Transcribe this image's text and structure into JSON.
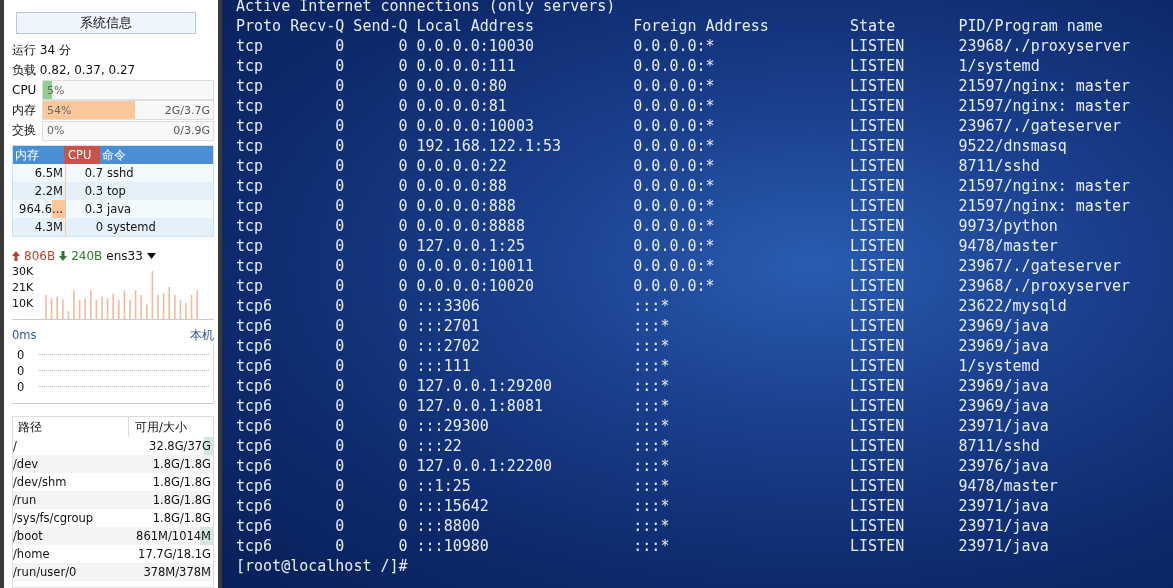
{
  "sidebar": {
    "title": "系统信息",
    "uptime": "运行 34 分",
    "load": "负载 0.82, 0.37, 0.27",
    "meters": [
      {
        "label": "CPU",
        "reading": "5%",
        "level": 0.05,
        "color": "#8fd08f"
      },
      {
        "label": "内存",
        "reading": "54%",
        "total": "2G/3.7G",
        "level": 0.54,
        "color": "#fcc89b"
      },
      {
        "label": "交换",
        "reading": "0%",
        "total": "0/3.9G"
      }
    ],
    "process_columns": [
      "内存",
      "CPU",
      "命令"
    ],
    "processes": [
      {
        "mem": "6.5M",
        "cpu": "0.7",
        "cmd": "sshd"
      },
      {
        "mem": "2.2M",
        "cpu": "0.3",
        "cmd": "top"
      },
      {
        "mem": "964.6...",
        "cpu": "0.3",
        "cmd": "java",
        "level": 0.25
      },
      {
        "mem": "4.3M",
        "cpu": "0",
        "cmd": "systemd"
      }
    ],
    "network": {
      "up": "806B",
      "down": "240B",
      "interface": "ens33",
      "yticks": [
        "30K",
        "21K",
        "10K"
      ]
    },
    "ping": {
      "latency": "0ms",
      "host": "本机",
      "yticks": [
        "0",
        "0",
        "0"
      ]
    },
    "disk_columns": [
      "路径",
      "可用/大小"
    ],
    "disks": [
      {
        "path": "/",
        "size": "32.8G/37G",
        "level": 0.1
      },
      {
        "path": "/dev",
        "size": "1.8G/1.8G"
      },
      {
        "path": "/dev/shm",
        "size": "1.8G/1.8G"
      },
      {
        "path": "/run",
        "size": "1.8G/1.8G"
      },
      {
        "path": "/sys/fs/cgroup",
        "size": "1.8G/1.8G"
      },
      {
        "path": "/boot",
        "size": "861M/1014M",
        "level": 0.15
      },
      {
        "path": "/home",
        "size": "17.7G/18.1G"
      },
      {
        "path": "/run/user/0",
        "size": "378M/378M"
      }
    ]
  },
  "terminal": {
    "heading": "Active Internet connections (only servers)",
    "columns": [
      "Proto",
      "Recv-Q",
      "Send-Q",
      "Local Address",
      "Foreign Address",
      "State",
      "PID/Program name"
    ],
    "rows": [
      [
        "tcp",
        "0",
        "0",
        "0.0.0.0:10030",
        "0.0.0.0:*",
        "LISTEN",
        "23968/./proxyserver"
      ],
      [
        "tcp",
        "0",
        "0",
        "0.0.0.0:111",
        "0.0.0.0:*",
        "LISTEN",
        "1/systemd"
      ],
      [
        "tcp",
        "0",
        "0",
        "0.0.0.0:80",
        "0.0.0.0:*",
        "LISTEN",
        "21597/nginx: master"
      ],
      [
        "tcp",
        "0",
        "0",
        "0.0.0.0:81",
        "0.0.0.0:*",
        "LISTEN",
        "21597/nginx: master"
      ],
      [
        "tcp",
        "0",
        "0",
        "0.0.0.0:10003",
        "0.0.0.0:*",
        "LISTEN",
        "23967/./gateserver"
      ],
      [
        "tcp",
        "0",
        "0",
        "192.168.122.1:53",
        "0.0.0.0:*",
        "LISTEN",
        "9522/dnsmasq"
      ],
      [
        "tcp",
        "0",
        "0",
        "0.0.0.0:22",
        "0.0.0.0:*",
        "LISTEN",
        "8711/sshd"
      ],
      [
        "tcp",
        "0",
        "0",
        "0.0.0.0:88",
        "0.0.0.0:*",
        "LISTEN",
        "21597/nginx: master"
      ],
      [
        "tcp",
        "0",
        "0",
        "0.0.0.0:888",
        "0.0.0.0:*",
        "LISTEN",
        "21597/nginx: master"
      ],
      [
        "tcp",
        "0",
        "0",
        "0.0.0.0:8888",
        "0.0.0.0:*",
        "LISTEN",
        "9973/python"
      ],
      [
        "tcp",
        "0",
        "0",
        "127.0.0.1:25",
        "0.0.0.0:*",
        "LISTEN",
        "9478/master"
      ],
      [
        "tcp",
        "0",
        "0",
        "0.0.0.0:10011",
        "0.0.0.0:*",
        "LISTEN",
        "23967/./gateserver"
      ],
      [
        "tcp",
        "0",
        "0",
        "0.0.0.0:10020",
        "0.0.0.0:*",
        "LISTEN",
        "23968/./proxyserver"
      ],
      [
        "tcp6",
        "0",
        "0",
        ":::3306",
        ":::*",
        "LISTEN",
        "23622/mysqld"
      ],
      [
        "tcp6",
        "0",
        "0",
        ":::2701",
        ":::*",
        "LISTEN",
        "23969/java"
      ],
      [
        "tcp6",
        "0",
        "0",
        ":::2702",
        ":::*",
        "LISTEN",
        "23969/java"
      ],
      [
        "tcp6",
        "0",
        "0",
        ":::111",
        ":::*",
        "LISTEN",
        "1/systemd"
      ],
      [
        "tcp6",
        "0",
        "0",
        "127.0.0.1:29200",
        ":::*",
        "LISTEN",
        "23969/java"
      ],
      [
        "tcp6",
        "0",
        "0",
        "127.0.0.1:8081",
        ":::*",
        "LISTEN",
        "23969/java"
      ],
      [
        "tcp6",
        "0",
        "0",
        ":::29300",
        ":::*",
        "LISTEN",
        "23971/java"
      ],
      [
        "tcp6",
        "0",
        "0",
        ":::22",
        ":::*",
        "LISTEN",
        "8711/sshd"
      ],
      [
        "tcp6",
        "0",
        "0",
        "127.0.0.1:22200",
        ":::*",
        "LISTEN",
        "23976/java"
      ],
      [
        "tcp6",
        "0",
        "0",
        "::1:25",
        ":::*",
        "LISTEN",
        "9478/master"
      ],
      [
        "tcp6",
        "0",
        "0",
        ":::15642",
        ":::*",
        "LISTEN",
        "23971/java"
      ],
      [
        "tcp6",
        "0",
        "0",
        ":::8800",
        ":::*",
        "LISTEN",
        "23971/java"
      ],
      [
        "tcp6",
        "0",
        "0",
        ":::10980",
        ":::*",
        "LISTEN",
        "23971/java"
      ]
    ],
    "prompt": "[root@localhost /]#"
  }
}
